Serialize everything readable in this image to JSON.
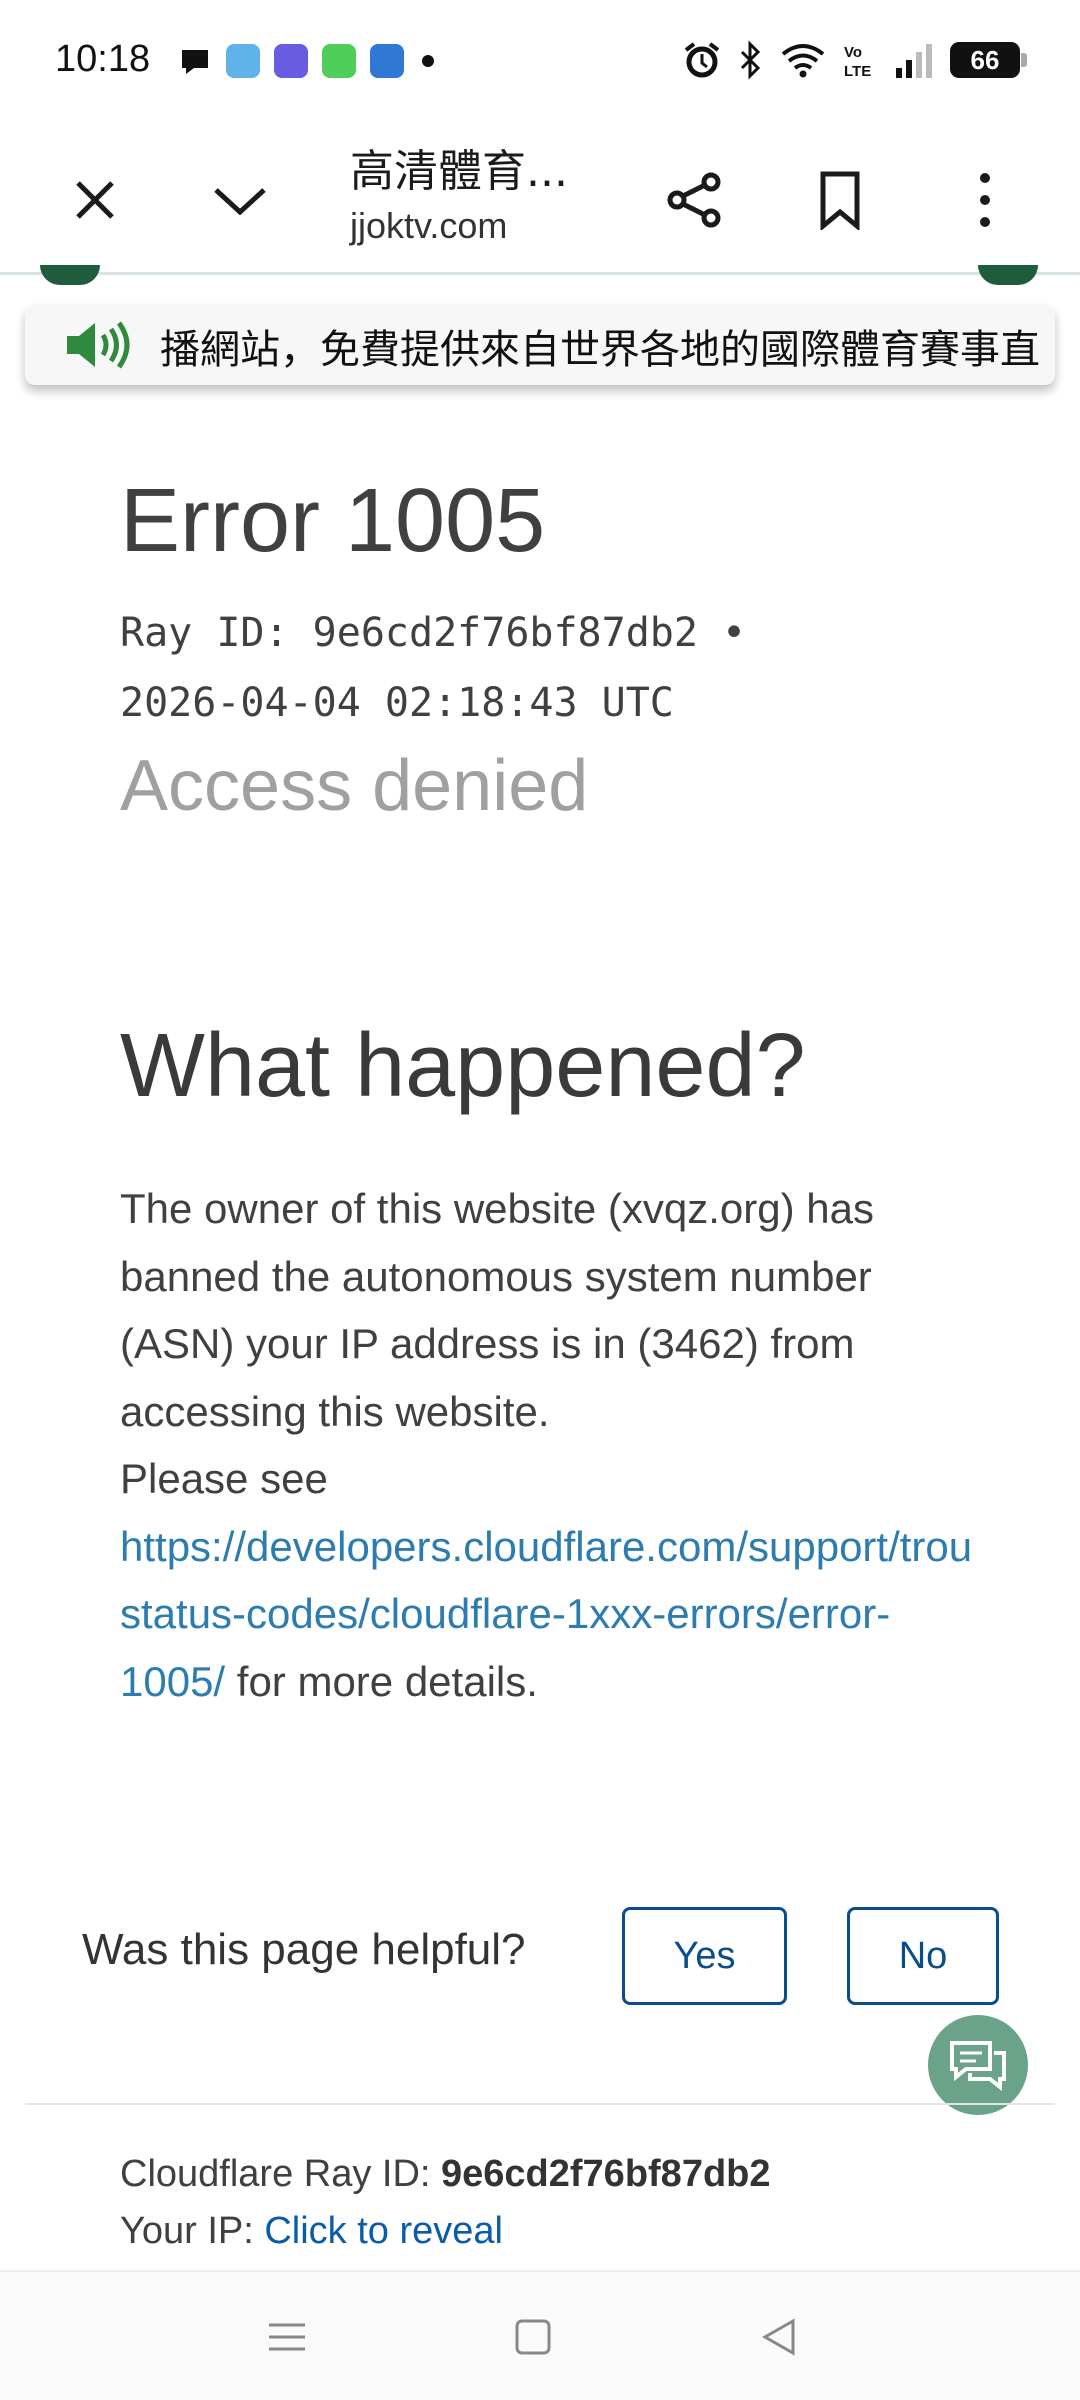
{
  "status_bar": {
    "time": "10:18",
    "battery": "66",
    "left_icons": [
      "chat-bubble-icon",
      "pdf-app-icon",
      "pdf-reader-icon",
      "calculator-app-icon",
      "word-app-icon",
      "notification-dot-icon"
    ],
    "right_icons": [
      "alarm-icon",
      "bluetooth-icon",
      "wifi-icon",
      "volte-icon",
      "signal-icon"
    ]
  },
  "toolbar": {
    "title": "高清體育...",
    "url": "jjoktv.com"
  },
  "banner": {
    "text": "播網站，免費提供來自世界各地的國際體育賽事直"
  },
  "main": {
    "error_title": "Error 1005",
    "ray_line1": "Ray ID: 9e6cd2f76bf87db2 •",
    "ray_line2": "2026-04-04 02:18:43 UTC",
    "access_denied": "Access denied",
    "what_happened": "What happened?",
    "body_text": "The owner of this website (xvqz.org) has banned the autonomous system number (ASN) your IP address is in (3462) from accessing this website.",
    "please_see": "Please see",
    "link_line1": "https://developers.cloudflare.com/support/trou",
    "link_line2": "status-codes/cloudflare-1xxx-errors/error-",
    "link_line3": "1005/",
    "more_details": " for more details."
  },
  "feedback": {
    "question": "Was this page helpful?",
    "yes_label": "Yes",
    "no_label": "No"
  },
  "footer": {
    "ray_label": "Cloudflare Ray ID: ",
    "ray_value": "9e6cd2f76bf87db2",
    "ip_label": "Your IP: ",
    "ip_link": "Click to reveal"
  },
  "colors": {
    "link": "#2c7cb0",
    "button_border": "#0b4c8c",
    "chat_fab": "#6aa38a",
    "banner_icon": "#2e8b3e"
  }
}
